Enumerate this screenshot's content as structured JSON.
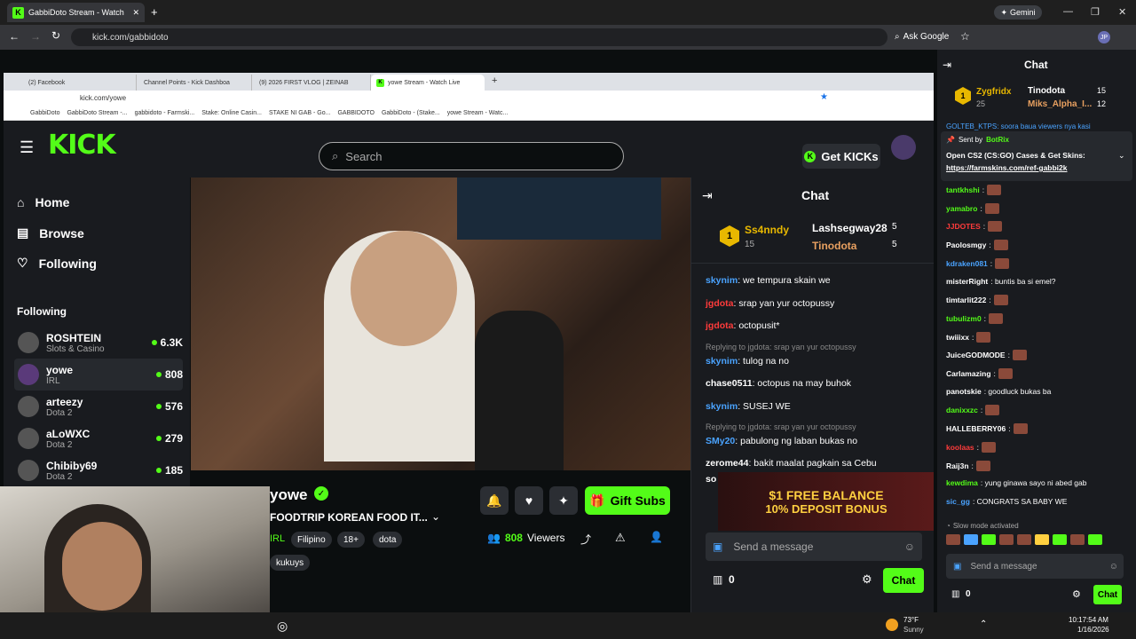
{
  "outer": {
    "tab_title": "GabbiDoto Stream - Watch",
    "url": "kick.com/gabbidoto",
    "ask_google": "Ask Google",
    "gemini": "Gemini",
    "profile": "JP"
  },
  "inner": {
    "tabs": [
      "(2) Facebook",
      "Channel Points - Kick Dashboa",
      "(9) 2026 FIRST VLOG | ZEINAB",
      "yowe Stream - Watch Live"
    ],
    "url": "kick.com/yowe",
    "bookmarks": [
      "GabbiDoto",
      "GabbiDoto Stream -...",
      "gabbidoto - Farmski...",
      "Stake: Online Casin...",
      "STAKE NI GAB - Go...",
      "GABBIDOTO",
      "GabbiDoto - (Stake...",
      "yowe Stream - Watc..."
    ]
  },
  "kick": {
    "search_placeholder": "Search",
    "get_kicks": "Get KICKs",
    "nav": {
      "home": "Home",
      "browse": "Browse",
      "following": "Following"
    },
    "following_header": "Following",
    "following": [
      {
        "name": "ROSHTEIN",
        "cat": "Slots & Casino",
        "viewers": "6.3K"
      },
      {
        "name": "yowe",
        "cat": "IRL",
        "viewers": "808"
      },
      {
        "name": "arteezy",
        "cat": "Dota 2",
        "viewers": "576"
      },
      {
        "name": "aLoWXC",
        "cat": "Dota 2",
        "viewers": "279"
      },
      {
        "name": "Chibiby69",
        "cat": "Dota 2",
        "viewers": "185"
      }
    ],
    "stream": {
      "name": "yowe",
      "title": "FOODTRIP KOREAN FOOD IT...",
      "tags": [
        "IRL",
        "Filipino",
        "18+",
        "dota",
        "kukuys"
      ],
      "viewers": "808",
      "viewers_label": "Viewers",
      "gift_subs": "Gift Subs"
    },
    "chat": {
      "title": "Chat",
      "leader": {
        "rank1": "Ss4nndy",
        "rank1_count": "15",
        "rank2": "Lashsegway28",
        "rank2_count": "5",
        "rank3": "Tinodota",
        "rank3_count": "5"
      },
      "messages": [
        {
          "user": "skynim",
          "text": ": we tempura skain we",
          "color": "#4aa3ff"
        },
        {
          "user": "jgdota",
          "text": ": srap yan yur octopussy",
          "color": "#ff3b3b"
        },
        {
          "user": "jgdota",
          "text": ": octopusit*",
          "color": "#ff3b3b"
        },
        {
          "reply": "Replying to jgdota: srap yan yur octopussy"
        },
        {
          "user": "skynim",
          "text": ": tulog na no",
          "color": "#4aa3ff"
        },
        {
          "user": "chase0511",
          "text": ": octopus na may buhok",
          "color": "#ffffff"
        },
        {
          "user": "skynim",
          "text": ": SUSEJ WE",
          "color": "#4aa3ff"
        },
        {
          "reply": "Replying to jgdota: srap yan yur octopussy"
        },
        {
          "user": "SMy20",
          "text": ": pabulong ng laban bukas no",
          "color": "#4aa3ff"
        },
        {
          "user": "zerome44",
          "text": ": bakit maalat pagkain sa Cebu",
          "color": "#ffffff"
        },
        {
          "user": "so",
          "text": "",
          "color": "#ffffff"
        }
      ],
      "promo_line1": "$1 FREE BALANCE",
      "promo_line2": "10% DEPOSIT BONUS",
      "send_placeholder": "Send a message",
      "points": "0",
      "chat_button": "Chat"
    }
  },
  "right_chat": {
    "title": "Chat",
    "leader": {
      "rank1": "Zygfridx",
      "rank1_count": "25",
      "rank2": "Tinodota",
      "rank2_count": "15",
      "rank3": "Miks_Alpha_I...",
      "rank3_count": "12"
    },
    "scroll_text": "GOLTEB_KTPS: soora baua viewers nya kasi",
    "pinned": {
      "sent_by": "Sent by",
      "bot": "BotRix",
      "text": "Open CS2 (CS:GO) Cases & Get Skins:",
      "link": "https://farmskins.com/ref-gabbi2k"
    },
    "messages": [
      {
        "user": "tantkhshi",
        "text": ":",
        "color": "#53fc18"
      },
      {
        "user": "yamabro",
        "text": ":",
        "color": "#53fc18"
      },
      {
        "user": "JJDOTES",
        "text": ":",
        "color": "#ff3b3b"
      },
      {
        "user": "Paolosmgy",
        "text": ":",
        "color": "#ffffff"
      },
      {
        "user": "kdraken081",
        "text": ":",
        "color": "#4aa3ff"
      },
      {
        "user": "misterRight",
        "text": ": buntis ba si emel?",
        "color": "#ffffff"
      },
      {
        "user": "timtarlit222",
        "text": ":",
        "color": "#ffffff"
      },
      {
        "user": "tubulizm0",
        "text": ":",
        "color": "#53fc18"
      },
      {
        "user": "twiiixx",
        "text": ":",
        "color": "#ffffff"
      },
      {
        "user": "JuiceGODMODE",
        "text": ":",
        "color": "#ffffff"
      },
      {
        "user": "Carlamazing",
        "text": ":",
        "color": "#ffffff"
      },
      {
        "user": "panotskie",
        "text": ": goodluck bukas ba",
        "color": "#ffffff"
      },
      {
        "user": "danixxzc",
        "text": ":",
        "color": "#53fc18"
      },
      {
        "user": "HALLEBERRY06",
        "text": ":",
        "color": "#ffffff"
      },
      {
        "user": "koolaas",
        "text": ":",
        "color": "#ff3b3b"
      },
      {
        "user": "Raij3n",
        "text": ":",
        "color": "#ffffff"
      },
      {
        "user": "kewdima",
        "text": ": yung ginawa sayo ni abed gab",
        "color": "#53fc18"
      },
      {
        "user": "sic_gg",
        "text": ": CONGRATS SA BABY WE",
        "color": "#4aa3ff"
      }
    ],
    "slow_mode": "Slow mode activated",
    "send_placeholder": "Send a message",
    "points": "0",
    "chat_button": "Chat"
  },
  "taskbar": {
    "temp": "73°F",
    "weather": "Sunny",
    "time": "10:17:54 AM",
    "date": "1/16/2026"
  }
}
